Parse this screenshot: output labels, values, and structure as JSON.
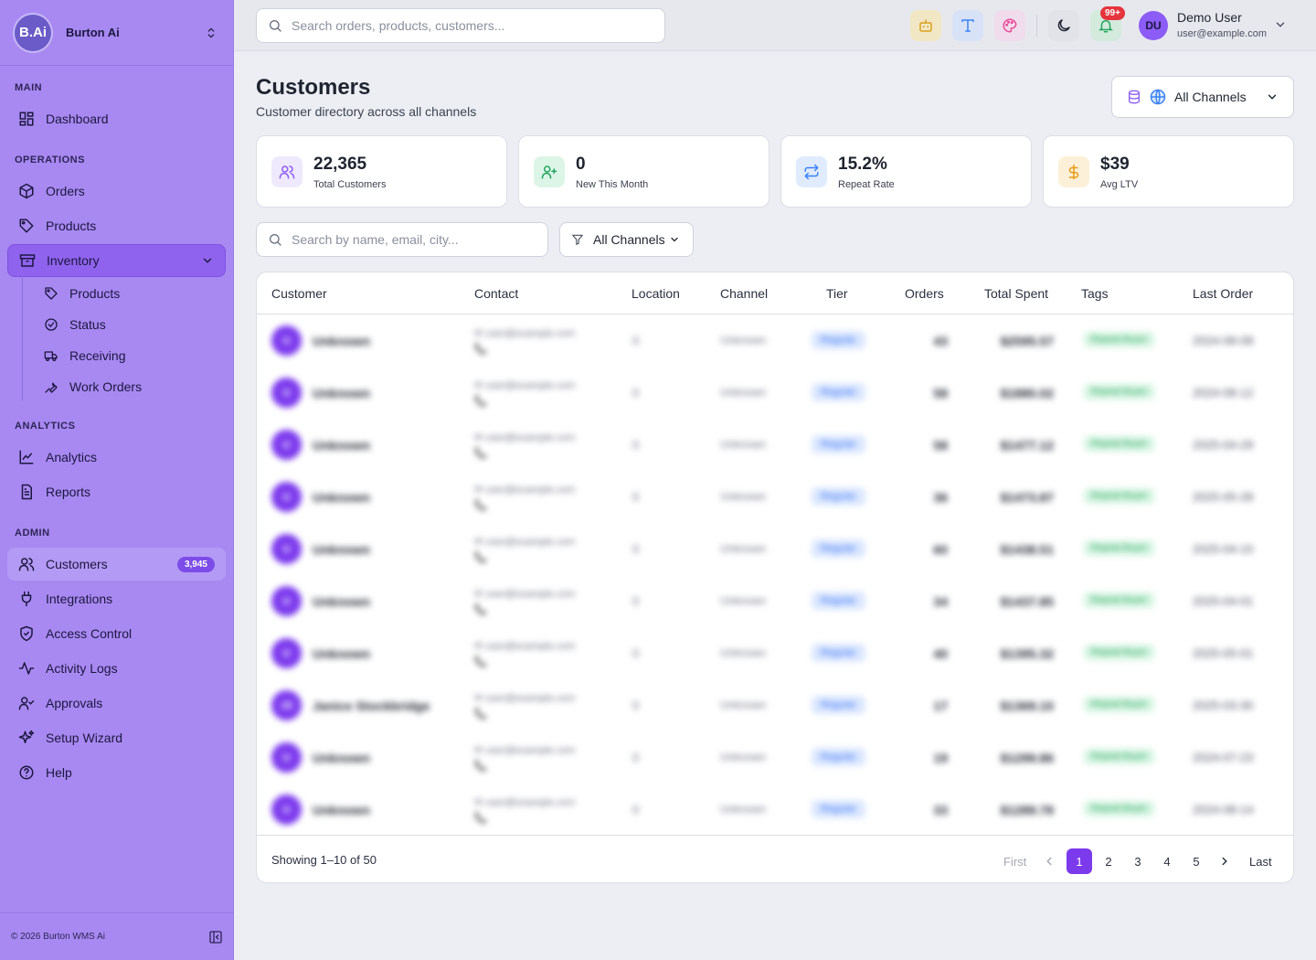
{
  "brand": {
    "logo": "B.Ai",
    "name": "Burton Ai"
  },
  "nav": {
    "sections": [
      "MAIN",
      "OPERATIONS",
      "ANALYTICS",
      "ADMIN"
    ],
    "dashboard": "Dashboard",
    "orders": "Orders",
    "products": "Products",
    "inventory": "Inventory",
    "inventory_sub": [
      "Products",
      "Status",
      "Receiving",
      "Work Orders"
    ],
    "analytics": "Analytics",
    "reports": "Reports",
    "customers": "Customers",
    "customers_badge": "3,945",
    "integrations": "Integrations",
    "access_control": "Access Control",
    "activity_logs": "Activity Logs",
    "approvals": "Approvals",
    "setup_wizard": "Setup Wizard",
    "help": "Help"
  },
  "footer": {
    "copyright": "© 2026 Burton WMS Ai"
  },
  "topbar": {
    "search_placeholder": "Search orders, products, customers...",
    "notif_badge": "99+",
    "user_initials": "DU",
    "user_name": "Demo User",
    "user_email": "user@example.com"
  },
  "page": {
    "title": "Customers",
    "subtitle": "Customer directory across all channels",
    "channel_select": "All Channels"
  },
  "stats": [
    {
      "value": "22,365",
      "label": "Total Customers"
    },
    {
      "value": "0",
      "label": "New This Month"
    },
    {
      "value": "15.2%",
      "label": "Repeat Rate"
    },
    {
      "value": "$39",
      "label": "Avg LTV"
    }
  ],
  "filters": {
    "search_placeholder": "Search by name, email, city...",
    "channel_filter": "All Channels"
  },
  "table": {
    "headers": [
      "Customer",
      "Contact",
      "Location",
      "Channel",
      "Tier",
      "Orders",
      "Total Spent",
      "Tags",
      "Last Order"
    ],
    "rows": [
      {
        "initials": "U",
        "name": "Unknown",
        "email": "✉ user@example.com",
        "phone": "📞",
        "location": "0",
        "channel": "Unknown",
        "tier": "Regular",
        "orders": "43",
        "spent": "$2595.57",
        "tag": "Repeat Buyer",
        "last": "2024-08-08"
      },
      {
        "initials": "U",
        "name": "Unknown",
        "email": "✉ user@example.com",
        "phone": "📞",
        "location": "0",
        "channel": "Unknown",
        "tier": "Regular",
        "orders": "58",
        "spent": "$1880.02",
        "tag": "Repeat Buyer",
        "last": "2024-08-12"
      },
      {
        "initials": "U",
        "name": "Unknown",
        "email": "✉ user@example.com",
        "phone": "📞",
        "location": "0",
        "channel": "Unknown",
        "tier": "Regular",
        "orders": "58",
        "spent": "$1477.12",
        "tag": "Repeat Buyer",
        "last": "2025-04-29"
      },
      {
        "initials": "U",
        "name": "Unknown",
        "email": "✉ user@example.com",
        "phone": "📞",
        "location": "0",
        "channel": "Unknown",
        "tier": "Regular",
        "orders": "36",
        "spent": "$1473.87",
        "tag": "Repeat Buyer",
        "last": "2025-05-28"
      },
      {
        "initials": "U",
        "name": "Unknown",
        "email": "✉ user@example.com",
        "phone": "📞",
        "location": "0",
        "channel": "Unknown",
        "tier": "Regular",
        "orders": "60",
        "spent": "$1438.51",
        "tag": "Repeat Buyer",
        "last": "2025-04-15"
      },
      {
        "initials": "U",
        "name": "Unknown",
        "email": "✉ user@example.com",
        "phone": "📞",
        "location": "0",
        "channel": "Unknown",
        "tier": "Regular",
        "orders": "34",
        "spent": "$1437.85",
        "tag": "Repeat Buyer",
        "last": "2025-04-01"
      },
      {
        "initials": "U",
        "name": "Unknown",
        "email": "✉ user@example.com",
        "phone": "📞",
        "location": "0",
        "channel": "Unknown",
        "tier": "Regular",
        "orders": "40",
        "spent": "$1395.32",
        "tag": "Repeat Buyer",
        "last": "2025-05-01"
      },
      {
        "initials": "JS",
        "name": "Janice Stockbridge",
        "email": "✉ user@example.com",
        "phone": "📞",
        "location": "0",
        "channel": "Unknown",
        "tier": "Regular",
        "orders": "17",
        "spent": "$1369.10",
        "tag": "Repeat Buyer",
        "last": "2025-03-30"
      },
      {
        "initials": "U",
        "name": "Unknown",
        "email": "✉ user@example.com",
        "phone": "📞",
        "location": "0",
        "channel": "Unknown",
        "tier": "Regular",
        "orders": "19",
        "spent": "$1299.86",
        "tag": "Repeat Buyer",
        "last": "2024-07-23"
      },
      {
        "initials": "U",
        "name": "Unknown",
        "email": "✉ user@example.com",
        "phone": "📞",
        "location": "0",
        "channel": "Unknown",
        "tier": "Regular",
        "orders": "33",
        "spent": "$1289.78",
        "tag": "Repeat Buyer",
        "last": "2024-08-14"
      }
    ],
    "showing": "Showing 1–10 of 50",
    "pagination": {
      "first": "First",
      "last": "Last",
      "pages": [
        "1",
        "2",
        "3",
        "4",
        "5"
      ]
    }
  },
  "colors": {
    "accent": "#7c3aed",
    "sidebar": "#a889f2",
    "page_bg": "#eceef4"
  }
}
